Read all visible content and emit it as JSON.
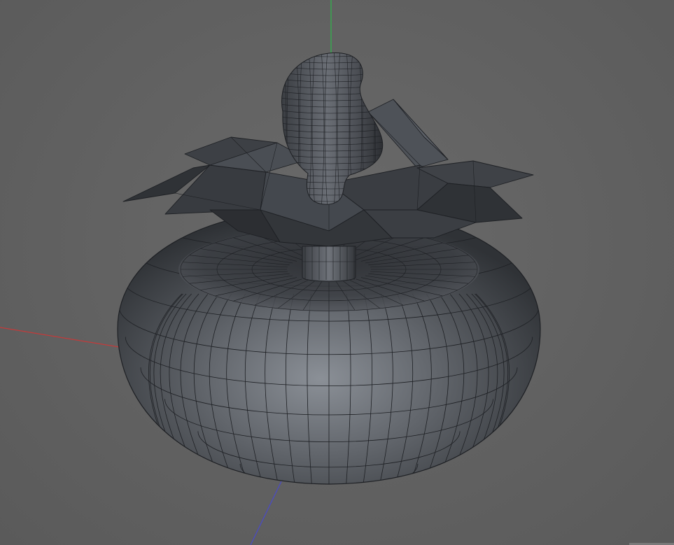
{
  "viewport": {
    "background": "#5f5f5f",
    "axes": {
      "x_color": "#c43a3a",
      "y_color": "#2fb84a",
      "z_color": "#4a4ac8"
    },
    "objects": [
      "torus-body",
      "spiked-crown",
      "deformed-stem",
      "connector-cylinder"
    ],
    "mesh_color": "#4a4d52",
    "wire_color": "#1e2024"
  }
}
